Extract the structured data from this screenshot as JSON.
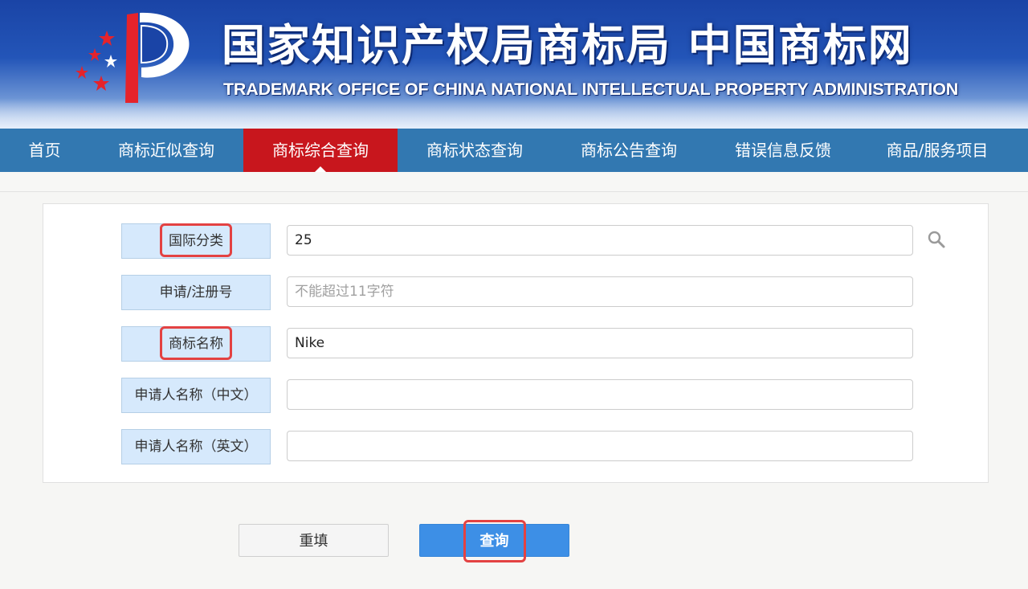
{
  "header": {
    "title_cn": "国家知识产权局商标局 中国商标网",
    "title_en": "TRADEMARK OFFICE OF CHINA NATIONAL INTELLECTUAL PROPERTY ADMINISTRATION"
  },
  "nav": {
    "items": [
      {
        "label": "首页"
      },
      {
        "label": "商标近似查询"
      },
      {
        "label": "商标综合查询"
      },
      {
        "label": "商标状态查询"
      },
      {
        "label": "商标公告查询"
      },
      {
        "label": "错误信息反馈"
      },
      {
        "label": "商品/服务项目"
      }
    ],
    "active": "商标综合查询"
  },
  "form": {
    "fields": [
      {
        "label": "国际分类",
        "value": "25",
        "placeholder": ""
      },
      {
        "label": "申请/注册号",
        "value": "",
        "placeholder": "不能超过11字符"
      },
      {
        "label": "商标名称",
        "value": "Nike",
        "placeholder": ""
      },
      {
        "label": "申请人名称（中文）",
        "value": "",
        "placeholder": ""
      },
      {
        "label": "申请人名称（英文）",
        "value": "",
        "placeholder": ""
      }
    ]
  },
  "buttons": {
    "reset_label": "重填",
    "query_label": "查询"
  },
  "colors": {
    "nav_bg": "#3278b1",
    "nav_active": "#c8161d",
    "label_bg": "#d6e9fc",
    "query_button": "#3d8fe6",
    "highlight": "#e34242"
  },
  "icons": {
    "logo": "cnipa-logo-icon",
    "search": "search-icon"
  }
}
